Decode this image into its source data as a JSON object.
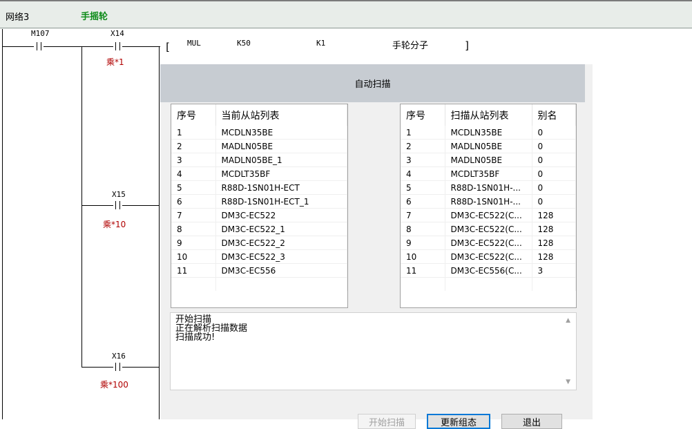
{
  "network": {
    "number_label": "网络3",
    "comment": "手摇轮"
  },
  "rung": {
    "m107": "M107",
    "x14": "X14",
    "x14_comment": "乘*1",
    "x15": "X15",
    "x15_comment": "乘*10",
    "x16": "X16",
    "x16_comment": "乘*100",
    "instruction": {
      "open": "[",
      "op": "MUL",
      "s1": "K50",
      "s2": "K1",
      "dest": "手轮分子",
      "close": "]"
    }
  },
  "dialog": {
    "title": "自动扫描",
    "current_list": {
      "headers": [
        "序号",
        "当前从站列表"
      ],
      "rows": [
        [
          "1",
          "MCDLN35BE"
        ],
        [
          "2",
          "MADLN05BE"
        ],
        [
          "3",
          "MADLN05BE_1"
        ],
        [
          "4",
          "MCDLT35BF"
        ],
        [
          "5",
          "R88D-1SN01H-ECT"
        ],
        [
          "6",
          "R88D-1SN01H-ECT_1"
        ],
        [
          "7",
          "DM3C-EC522"
        ],
        [
          "8",
          "DM3C-EC522_1"
        ],
        [
          "9",
          "DM3C-EC522_2"
        ],
        [
          "10",
          "DM3C-EC522_3"
        ],
        [
          "11",
          "DM3C-EC556"
        ]
      ]
    },
    "scan_list": {
      "headers": [
        "序号",
        "扫描从站列表",
        "别名"
      ],
      "rows": [
        [
          "1",
          "MCDLN35BE",
          "0"
        ],
        [
          "2",
          "MADLN05BE",
          "0"
        ],
        [
          "3",
          "MADLN05BE",
          "0"
        ],
        [
          "4",
          "MCDLT35BF",
          "0"
        ],
        [
          "5",
          "R88D-1SN01H-...",
          "0"
        ],
        [
          "6",
          "R88D-1SN01H-...",
          "0"
        ],
        [
          "7",
          "DM3C-EC522(C...",
          "128"
        ],
        [
          "8",
          "DM3C-EC522(C...",
          "128"
        ],
        [
          "9",
          "DM3C-EC522(C...",
          "128"
        ],
        [
          "10",
          "DM3C-EC522(C...",
          "128"
        ],
        [
          "11",
          "DM3C-EC556(C...",
          "3"
        ]
      ]
    },
    "log": [
      "开始扫描",
      "正在解析扫描数据",
      "扫描成功!"
    ],
    "buttons": {
      "start_scan": "开始扫描",
      "update": "更新组态",
      "exit": "退出"
    }
  },
  "colors": {
    "comment_green": "#0b8a17",
    "comment_red": "#b00000",
    "title_bar": "#c7ccd2",
    "default_button_border": "#0078d7"
  }
}
